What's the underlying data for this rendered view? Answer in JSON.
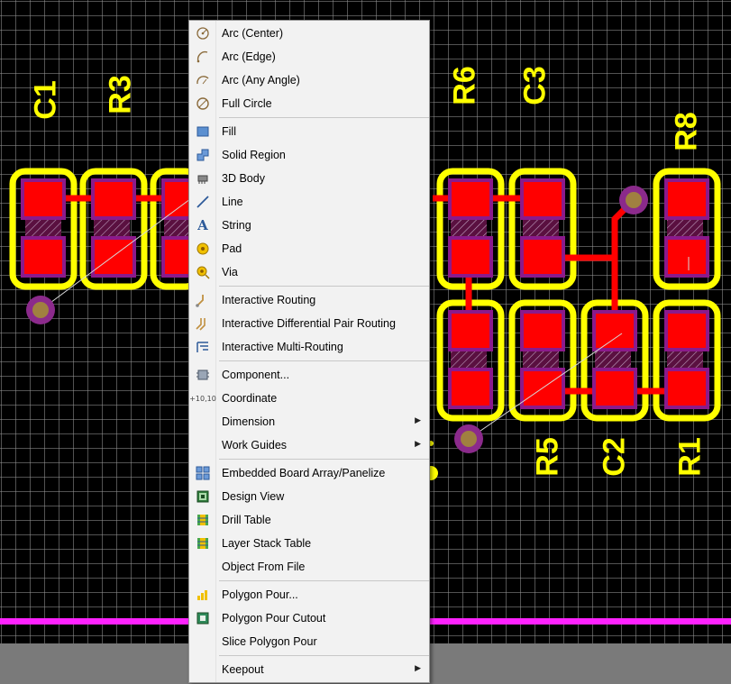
{
  "pcb": {
    "designators": [
      {
        "id": "c1",
        "text": "C1"
      },
      {
        "id": "r3",
        "text": "R3"
      },
      {
        "id": "r6",
        "text": "R6"
      },
      {
        "id": "c3",
        "text": "C3"
      },
      {
        "id": "r8",
        "text": "R8"
      },
      {
        "id": "r5",
        "text": "R5"
      },
      {
        "id": "c2",
        "text": "C2"
      },
      {
        "id": "r1",
        "text": "R1"
      }
    ],
    "colors": {
      "background": "#000000",
      "grid": "#969696",
      "overlay": "#ffff00",
      "copper": "#ff0000",
      "solder_mask": "#8b1a8b",
      "via_ring": "#8b2a8b",
      "via_hole": "#a08040",
      "board_edge": "#ff22ff",
      "bottom_strip": "#7a7a7a"
    }
  },
  "menu": {
    "items": [
      {
        "label": "Arc (Center)",
        "icon": "arc-center-icon"
      },
      {
        "label": "Arc (Edge)",
        "icon": "arc-edge-icon"
      },
      {
        "label": "Arc (Any Angle)",
        "icon": "arc-any-angle-icon"
      },
      {
        "label": "Full Circle",
        "icon": "full-circle-icon"
      },
      {
        "label": "Fill",
        "icon": "fill-icon"
      },
      {
        "label": "Solid Region",
        "icon": "solid-region-icon"
      },
      {
        "label": "3D Body",
        "icon": "3d-body-icon"
      },
      {
        "label": "Line",
        "icon": "line-icon"
      },
      {
        "label": "String",
        "icon": "string-icon"
      },
      {
        "label": "Pad",
        "icon": "pad-icon"
      },
      {
        "label": "Via",
        "icon": "via-icon"
      },
      {
        "label": "Interactive Routing",
        "icon": "interactive-routing-icon"
      },
      {
        "label": "Interactive Differential Pair Routing",
        "icon": "diff-pair-routing-icon"
      },
      {
        "label": "Interactive Multi-Routing",
        "icon": "multi-routing-icon"
      },
      {
        "label": "Component...",
        "icon": "component-icon"
      },
      {
        "label": "Coordinate",
        "icon": "coordinate-icon"
      },
      {
        "label": "Dimension",
        "icon": "none",
        "submenu": true
      },
      {
        "label": "Work Guides",
        "icon": "none",
        "submenu": true
      },
      {
        "label": "Embedded Board Array/Panelize",
        "icon": "board-array-icon"
      },
      {
        "label": "Design View",
        "icon": "design-view-icon"
      },
      {
        "label": "Drill Table",
        "icon": "drill-table-icon"
      },
      {
        "label": "Layer Stack Table",
        "icon": "layer-stack-table-icon"
      },
      {
        "label": "Object From File",
        "icon": "none"
      },
      {
        "label": "Polygon Pour...",
        "icon": "polygon-pour-icon"
      },
      {
        "label": "Polygon Pour Cutout",
        "icon": "polygon-pour-cutout-icon"
      },
      {
        "label": "Slice Polygon Pour",
        "icon": "none"
      },
      {
        "label": "Keepout",
        "icon": "none",
        "submenu": true
      }
    ],
    "submenu_arrow": "▶"
  }
}
